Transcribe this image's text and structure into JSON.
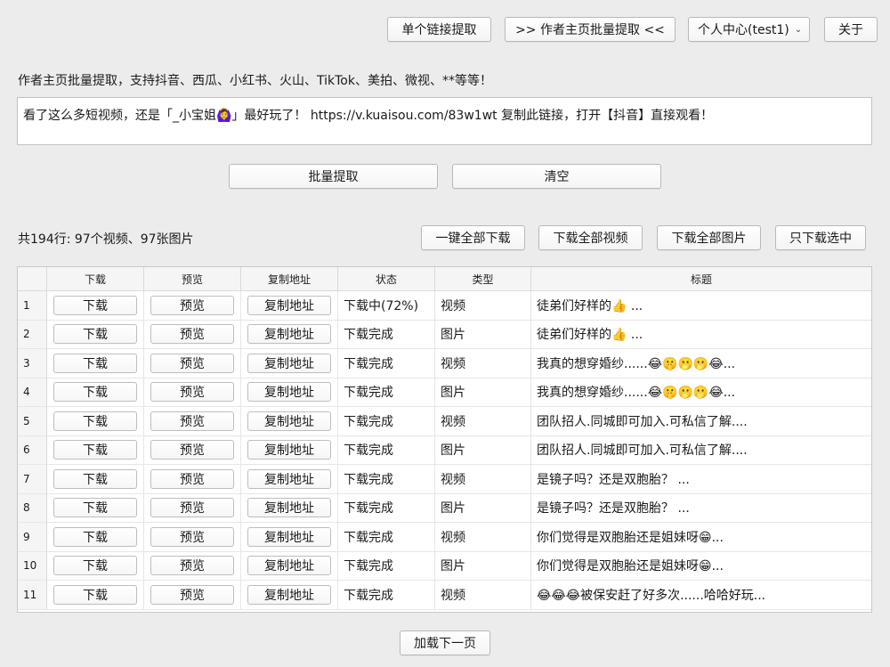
{
  "toolbar": {
    "single_extract": "单个链接提取",
    "batch_extract": ">> 作者主页批量提取 <<",
    "account_select": "个人中心(test1)",
    "about": "关于"
  },
  "description": "作者主页批量提取，支持抖音、西瓜、小红书、火山、TikTok、美拍、微视、**等等！",
  "input": {
    "value": "看了这么多短视频，还是「_小宝姐🙆‍♀️」最好玩了！ https://v.kuaisou.com/83w1wt 复制此链接，打开【抖音】直接观看！"
  },
  "actions": {
    "batch_extract": "批量提取",
    "clear": "清空"
  },
  "summary": "共194行: 97个视频、97张图片",
  "downloads": {
    "all": "一键全部下载",
    "all_videos": "下载全部视频",
    "all_images": "下载全部图片",
    "selected_only": "只下载选中"
  },
  "table": {
    "headers": [
      "",
      "下载",
      "预览",
      "复制地址",
      "状态",
      "类型",
      "标题"
    ],
    "button_labels": {
      "download": "下载",
      "preview": "预览",
      "copy": "复制地址"
    },
    "rows": [
      {
        "index": "1",
        "status": "下载中(72%)",
        "type": "视频",
        "title": "徒弟们好样的👍 ..."
      },
      {
        "index": "2",
        "status": "下载完成",
        "type": "图片",
        "title": "徒弟们好样的👍 ..."
      },
      {
        "index": "3",
        "status": "下载完成",
        "type": "视频",
        "title": "我真的想穿婚纱......😂🤫🫢🫢😂..."
      },
      {
        "index": "4",
        "status": "下载完成",
        "type": "图片",
        "title": "我真的想穿婚纱......😂🤫🫢🫢😂..."
      },
      {
        "index": "5",
        "status": "下载完成",
        "type": "视频",
        "title": "团队招人.同城即可加入.可私信了解...."
      },
      {
        "index": "6",
        "status": "下载完成",
        "type": "图片",
        "title": "团队招人.同城即可加入.可私信了解...."
      },
      {
        "index": "7",
        "status": "下载完成",
        "type": "视频",
        "title": "是镜子吗？还是双胞胎？ ..."
      },
      {
        "index": "8",
        "status": "下载完成",
        "type": "图片",
        "title": "是镜子吗？还是双胞胎？ ..."
      },
      {
        "index": "9",
        "status": "下载完成",
        "type": "视频",
        "title": "你们觉得是双胞胎还是姐妹呀😁..."
      },
      {
        "index": "10",
        "status": "下载完成",
        "type": "图片",
        "title": "你们觉得是双胞胎还是姐妹呀😁..."
      },
      {
        "index": "11",
        "status": "下载完成",
        "type": "视频",
        "title": "😂😂😂被保安赶了好多次......哈哈好玩..."
      }
    ]
  },
  "load_more": "加载下一页"
}
